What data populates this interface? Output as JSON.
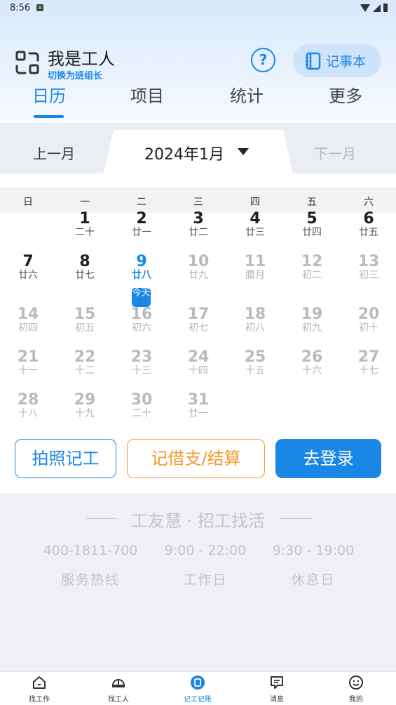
{
  "status_bar": {
    "time": "8:56"
  },
  "header": {
    "title": "我是工人",
    "switch_role": "切换为班组长",
    "help_label": "?",
    "notebook_label": "记事本"
  },
  "tabs": [
    {
      "label": "日历"
    },
    {
      "label": "项目"
    },
    {
      "label": "统计"
    },
    {
      "label": "更多"
    }
  ],
  "month_nav": {
    "prev": "上一月",
    "current": "2024年1月",
    "next": "下一月"
  },
  "weekdays": [
    "日",
    "一",
    "二",
    "三",
    "四",
    "五",
    "六"
  ],
  "calendar_days": [
    {
      "num": "1",
      "lunar": "二十",
      "state": "cur"
    },
    {
      "num": "2",
      "lunar": "廿一",
      "state": "cur"
    },
    {
      "num": "3",
      "lunar": "廿二",
      "state": "cur"
    },
    {
      "num": "4",
      "lunar": "廿三",
      "state": "cur"
    },
    {
      "num": "5",
      "lunar": "廿四",
      "state": "cur"
    },
    {
      "num": "6",
      "lunar": "廿五",
      "state": "cur"
    },
    {
      "num": "7",
      "lunar": "廿六",
      "state": "cur"
    },
    {
      "num": "8",
      "lunar": "廿七",
      "state": "cur"
    },
    {
      "num": "9",
      "lunar": "廿八",
      "state": "today"
    },
    {
      "num": "10",
      "lunar": "廿九",
      "state": "dim"
    },
    {
      "num": "11",
      "lunar": "腊月",
      "state": "dim"
    },
    {
      "num": "12",
      "lunar": "初二",
      "state": "dim"
    },
    {
      "num": "13",
      "lunar": "初三",
      "state": "dim"
    },
    {
      "num": "14",
      "lunar": "初四",
      "state": "dim"
    },
    {
      "num": "15",
      "lunar": "初五",
      "state": "dim"
    },
    {
      "num": "16",
      "lunar": "初六",
      "state": "dim"
    },
    {
      "num": "17",
      "lunar": "初七",
      "state": "dim"
    },
    {
      "num": "18",
      "lunar": "初八",
      "state": "dim"
    },
    {
      "num": "19",
      "lunar": "初九",
      "state": "dim"
    },
    {
      "num": "20",
      "lunar": "初十",
      "state": "dim"
    },
    {
      "num": "21",
      "lunar": "十一",
      "state": "dim"
    },
    {
      "num": "22",
      "lunar": "十二",
      "state": "dim"
    },
    {
      "num": "23",
      "lunar": "十三",
      "state": "dim"
    },
    {
      "num": "24",
      "lunar": "十四",
      "state": "dim"
    },
    {
      "num": "25",
      "lunar": "十五",
      "state": "dim"
    },
    {
      "num": "26",
      "lunar": "十六",
      "state": "dim"
    },
    {
      "num": "27",
      "lunar": "十七",
      "state": "dim"
    },
    {
      "num": "28",
      "lunar": "十八",
      "state": "dim"
    },
    {
      "num": "29",
      "lunar": "十九",
      "state": "dim"
    },
    {
      "num": "30",
      "lunar": "二十",
      "state": "dim"
    },
    {
      "num": "31",
      "lunar": "廿一",
      "state": "dim"
    }
  ],
  "today_badge": "今天",
  "actions": {
    "photo": "拍照记工",
    "borrow": "记借支/结算",
    "login": "去登录"
  },
  "footer": {
    "slogan": "工友慧 · 招工找活",
    "hotline": "400-1811-700",
    "hotline_label": "服务热线",
    "workday_hours": "9:00 - 22:00",
    "workday_label": "工作日",
    "restday_hours": "9:30 - 19:00",
    "restday_label": "休息日"
  },
  "bottom_nav": [
    {
      "label": "找工作",
      "icon": "home-icon"
    },
    {
      "label": "找工人",
      "icon": "helmet-icon"
    },
    {
      "label": "记工记账",
      "icon": "ledger-icon"
    },
    {
      "label": "消息",
      "icon": "message-icon"
    },
    {
      "label": "我的",
      "icon": "smiley-icon"
    }
  ],
  "colors": {
    "accent": "#1a86e6",
    "warning": "#f39b2d"
  }
}
